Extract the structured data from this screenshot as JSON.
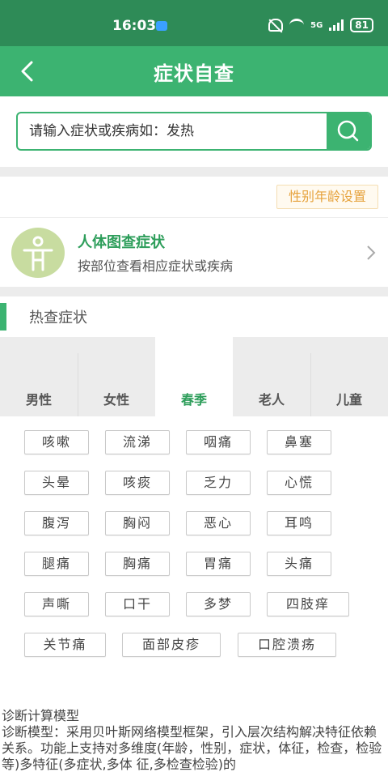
{
  "status": {
    "time": "16:03",
    "signal": "5G",
    "battery": "81"
  },
  "header": {
    "title": "症状自查"
  },
  "search": {
    "placeholder": "请输入症状或疾病如：发热"
  },
  "gender_age_button": "性别年龄设置",
  "body_map": {
    "title": "人体图查症状",
    "subtitle": "按部位查看相应症状或疾病"
  },
  "hot": {
    "title": "热查症状",
    "tabs": [
      "男性",
      "女性",
      "春季",
      "老人",
      "儿童"
    ],
    "active_tab": "春季",
    "symptoms": [
      [
        "咳嗽",
        "流涕",
        "咽痛",
        "鼻塞"
      ],
      [
        "头晕",
        "咳痰",
        "乏力",
        "心慌"
      ],
      [
        "腹泻",
        "胸闷",
        "恶心",
        "耳鸣"
      ],
      [
        "腿痛",
        "胸痛",
        "胃痛",
        "头痛"
      ],
      [
        "声嘶",
        "口干",
        "多梦",
        "四肢痒"
      ],
      [
        "关节痛",
        "面部皮疹",
        "口腔溃疡"
      ]
    ]
  },
  "model": {
    "title": "诊断计算模型",
    "text": "诊断模型：采用贝叶斯网络模型框架，引入层次结构解决特征依赖关系。功能上支持对多维度(年龄，性别，症状，体征，检查，检验等)多特征(多症状,多体 征,多检查检验)的"
  },
  "colors": {
    "primary": "#3cb371",
    "status_bar": "#2e8b57",
    "accent_gold": "#e6a23c"
  }
}
